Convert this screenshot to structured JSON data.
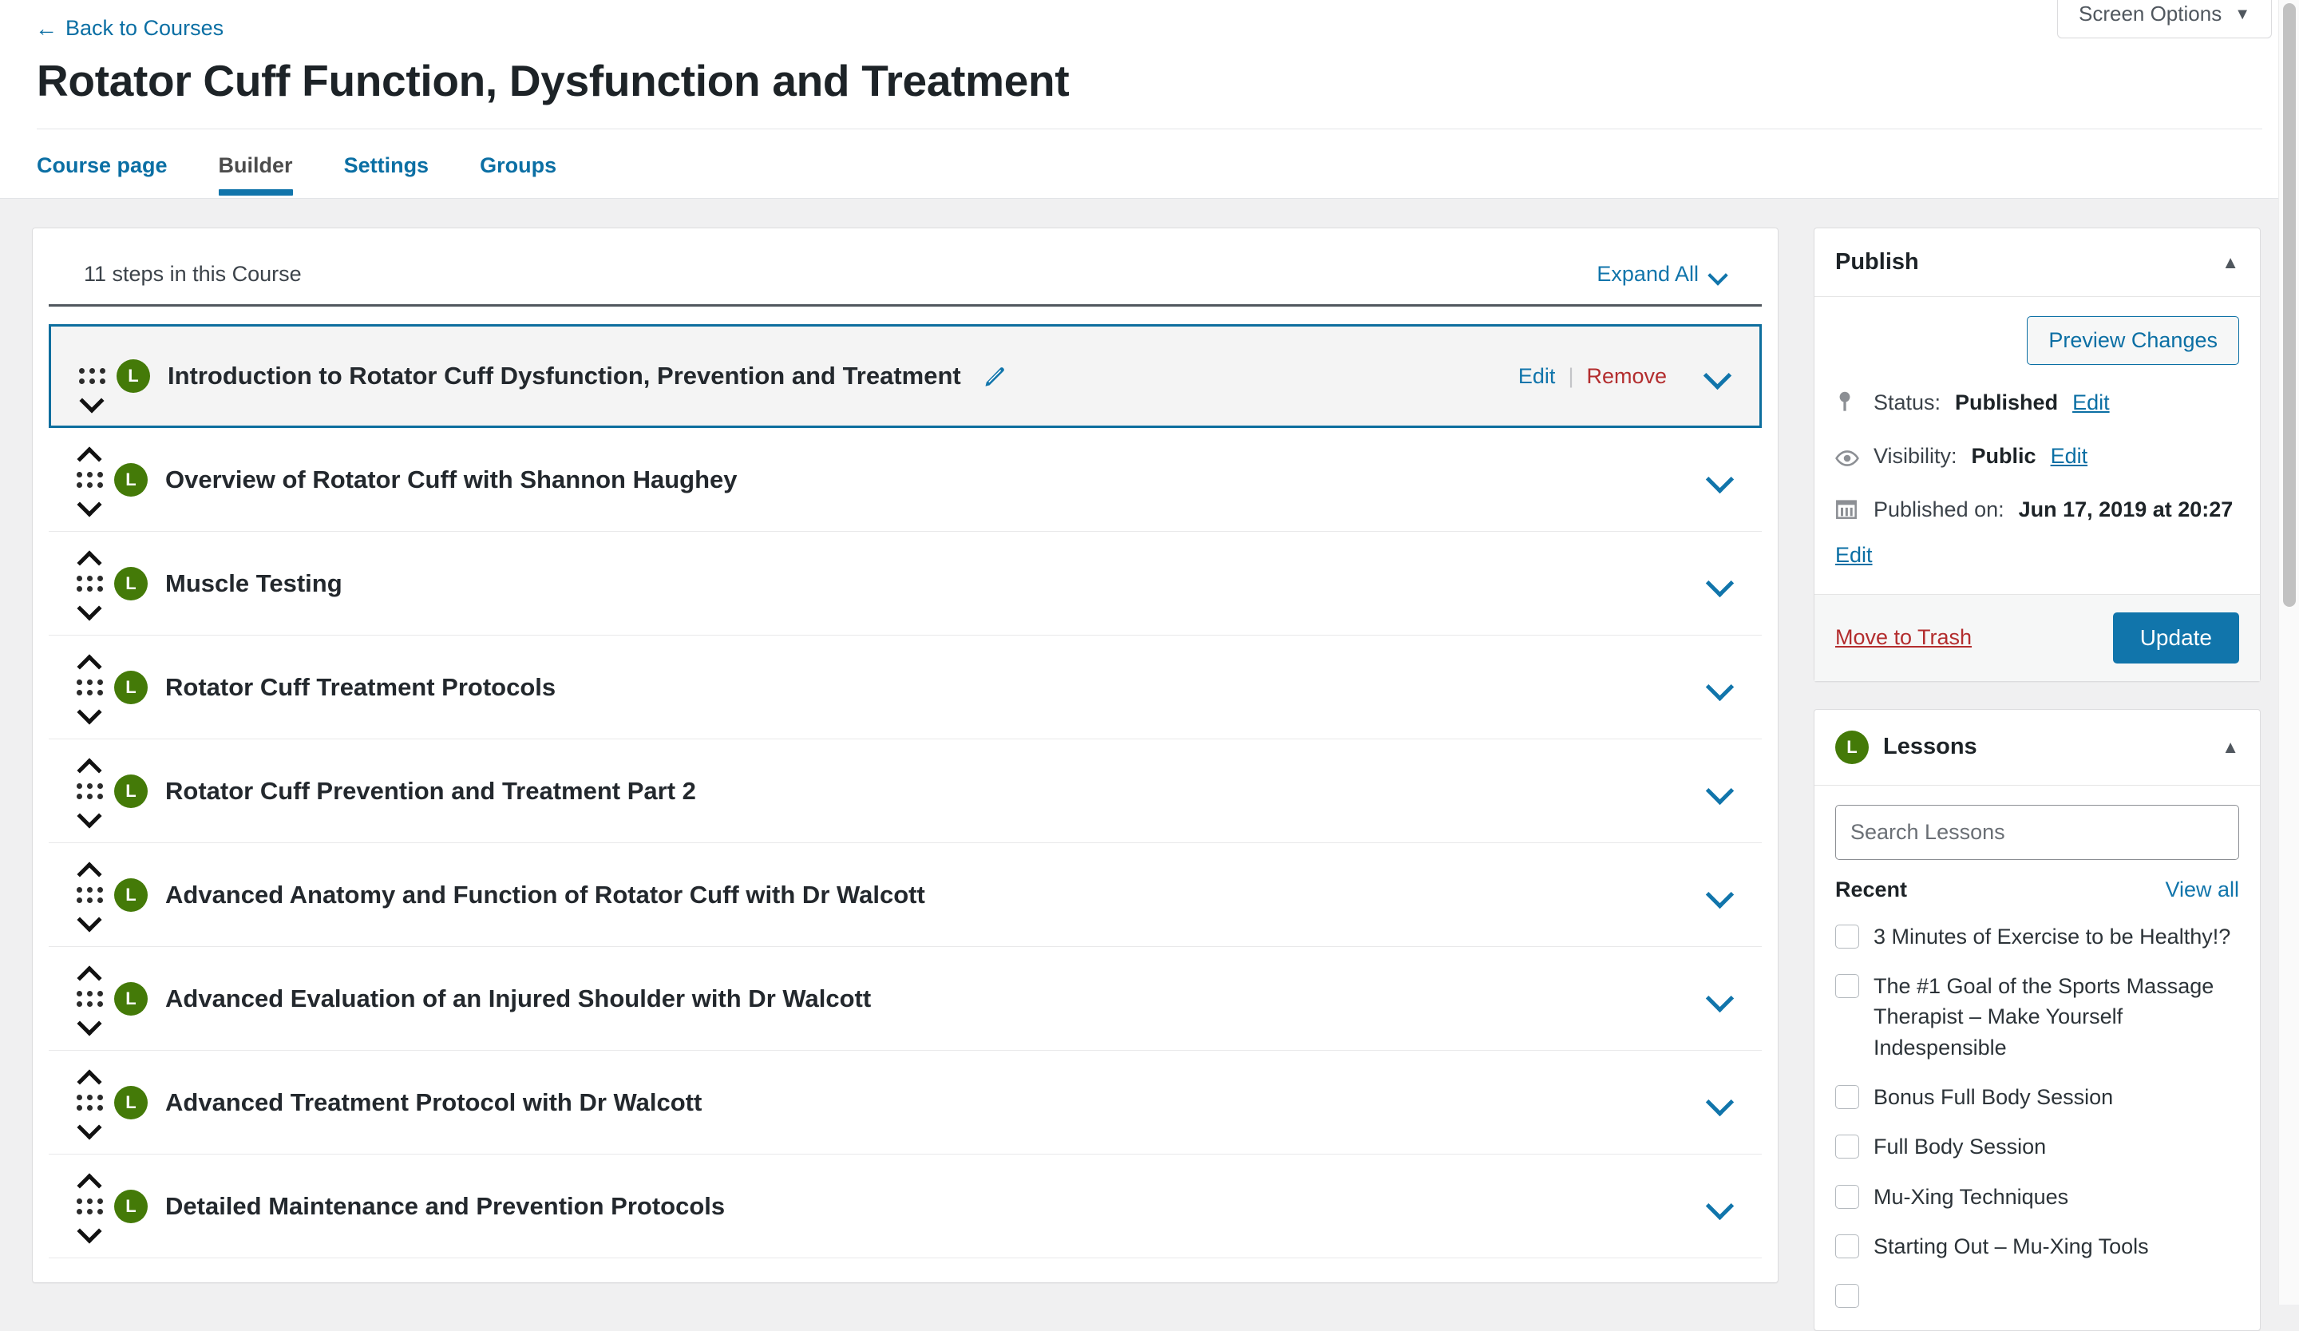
{
  "header": {
    "back_link": "Back to Courses",
    "back_icon": "arrow-left-icon",
    "title": "Rotator Cuff Function, Dysfunction and Treatment",
    "screen_options": {
      "label": "Screen Options",
      "caret": "▼"
    },
    "tabs": [
      {
        "label": "Course page",
        "active": false
      },
      {
        "label": "Builder",
        "active": true
      },
      {
        "label": "Settings",
        "active": false
      },
      {
        "label": "Groups",
        "active": false
      }
    ]
  },
  "builder": {
    "steps_count_label": "11 steps in this Course",
    "expand_all_label": "Expand All",
    "row_actions": {
      "edit": "Edit",
      "separator": "|",
      "remove": "Remove"
    },
    "badge_letter": "L",
    "steps": [
      {
        "title": "Introduction to Rotator Cuff Dysfunction, Prevention and Treatment",
        "selected": true,
        "has_up": false,
        "has_down": true,
        "has_pencil": true,
        "has_actions": true
      },
      {
        "title": "Overview of Rotator Cuff with Shannon Haughey",
        "selected": false,
        "has_up": true,
        "has_down": true,
        "has_pencil": false,
        "has_actions": false
      },
      {
        "title": "Muscle Testing",
        "selected": false,
        "has_up": true,
        "has_down": true,
        "has_pencil": false,
        "has_actions": false
      },
      {
        "title": "Rotator Cuff Treatment Protocols",
        "selected": false,
        "has_up": true,
        "has_down": true,
        "has_pencil": false,
        "has_actions": false
      },
      {
        "title": "Rotator Cuff Prevention and Treatment Part 2",
        "selected": false,
        "has_up": true,
        "has_down": true,
        "has_pencil": false,
        "has_actions": false
      },
      {
        "title": "Advanced Anatomy and Function of Rotator Cuff with Dr Walcott",
        "selected": false,
        "has_up": true,
        "has_down": true,
        "has_pencil": false,
        "has_actions": false
      },
      {
        "title": "Advanced Evaluation of an Injured Shoulder with Dr Walcott",
        "selected": false,
        "has_up": true,
        "has_down": true,
        "has_pencil": false,
        "has_actions": false
      },
      {
        "title": "Advanced Treatment Protocol with Dr Walcott",
        "selected": false,
        "has_up": true,
        "has_down": true,
        "has_pencil": false,
        "has_actions": false
      },
      {
        "title": "Detailed Maintenance and Prevention Protocols",
        "selected": false,
        "has_up": true,
        "has_down": true,
        "has_pencil": false,
        "has_actions": false
      }
    ]
  },
  "publish_panel": {
    "title": "Publish",
    "toggle": "▲",
    "preview_button": "Preview Changes",
    "status_label": "Status:",
    "status_value": "Published",
    "status_edit": "Edit",
    "visibility_label": "Visibility:",
    "visibility_value": "Public",
    "visibility_edit": "Edit",
    "published_label": "Published on:",
    "published_value": "Jun 17, 2019 at 20:27",
    "published_edit": "Edit",
    "trash_link": "Move to Trash",
    "update_button": "Update"
  },
  "lessons_panel": {
    "badge_letter": "L",
    "title": "Lessons",
    "toggle": "▲",
    "search_placeholder": "Search Lessons",
    "search_value": "",
    "recent_label": "Recent",
    "view_all_label": "View all",
    "items": [
      "3 Minutes of Exercise to be Healthy!?",
      "The #1 Goal of the Sports Massage Therapist – Make Yourself Indespensible",
      "Bonus Full Body Session",
      "Full Body Session",
      "Mu-Xing Techniques",
      "Starting Out – Mu-Xing Tools",
      ""
    ]
  },
  "colors": {
    "accent_blue": "#1175ab",
    "link_blue": "#0b6fa4",
    "lesson_green": "#447a08",
    "danger_red": "#b32d2e",
    "page_bg": "#f0f0f1"
  }
}
